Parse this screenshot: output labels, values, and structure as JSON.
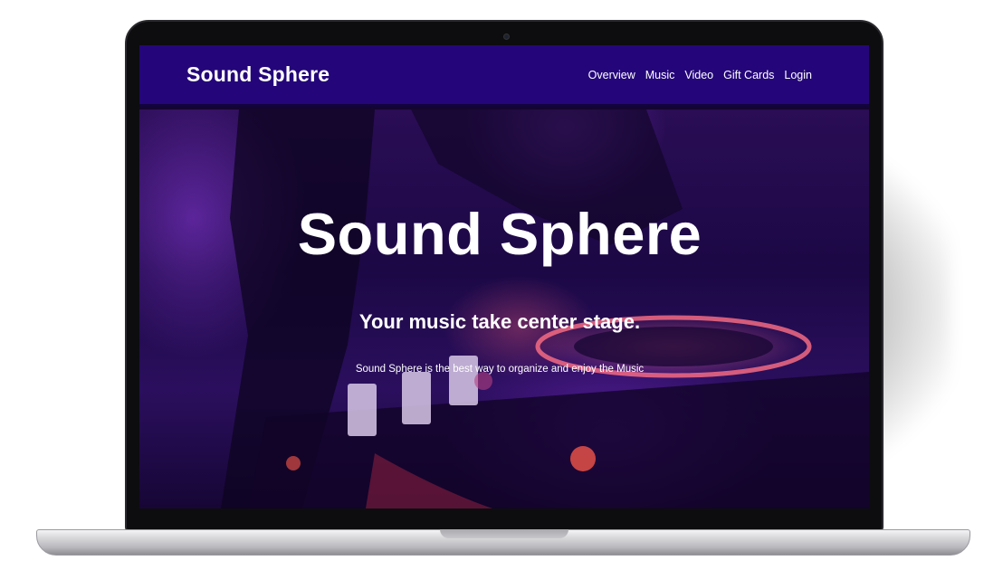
{
  "navbar": {
    "brand": "Sound Sphere",
    "links": [
      "Overview",
      "Music",
      "Video",
      "Gift Cards",
      "Login"
    ]
  },
  "hero": {
    "title": "Sound Sphere",
    "subtitle": "Your music take center stage.",
    "description": "Sound Sphere is the best way to organize and enjoy the Music"
  },
  "colors": {
    "navbar": "#24067a",
    "hero_tint": "#2b0f5e",
    "text": "#ffffff"
  }
}
